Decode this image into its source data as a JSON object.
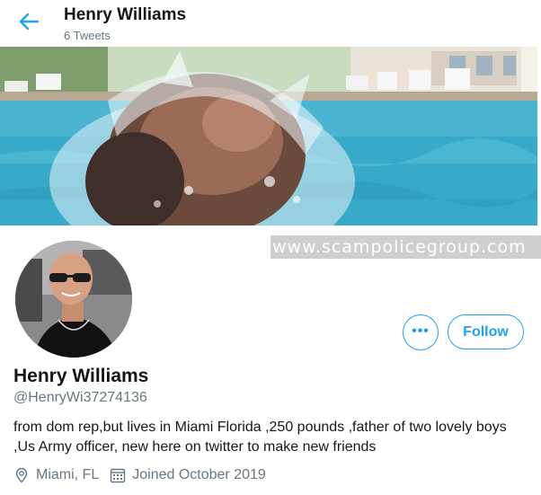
{
  "header": {
    "name": "Henry Williams",
    "tweet_count": "6 Tweets",
    "back_icon": "arrow-left-icon"
  },
  "watermark": "www.scampolicegroup.com",
  "profile": {
    "name": "Henry Williams",
    "handle": "@HenryWi37274136",
    "bio": "from dom rep,but lives in Miami Florida ,250 pounds ,father of two lovely boys ,Us Army officer, new here on twitter to make new friends",
    "location": "Miami, FL",
    "joined": "Joined October 2019"
  },
  "actions": {
    "more_label": "•••",
    "follow_label": "Follow"
  },
  "icons": {
    "location": "location-pin-icon",
    "calendar": "calendar-icon",
    "more": "more-icon"
  },
  "colors": {
    "accent": "#1da1f2",
    "secondary_text": "#657786",
    "primary_text": "#14171a"
  }
}
